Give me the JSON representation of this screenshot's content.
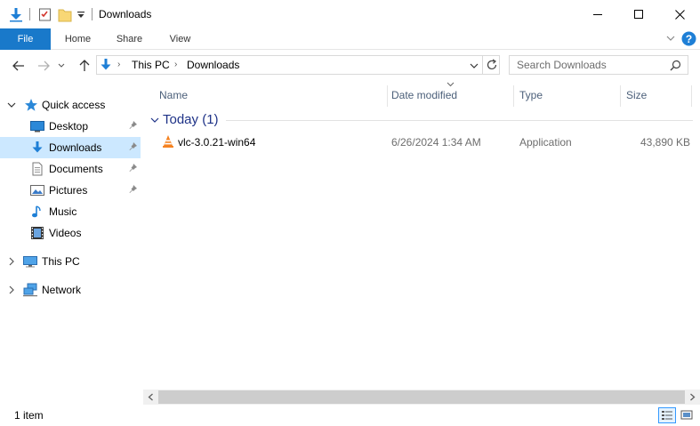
{
  "window": {
    "title": "Downloads",
    "controls": [
      "minimize-icon",
      "maximize-icon",
      "close-icon"
    ]
  },
  "ribbon": {
    "tabs": [
      {
        "label": "File",
        "active": true
      },
      {
        "label": "Home"
      },
      {
        "label": "Share"
      },
      {
        "label": "View"
      }
    ]
  },
  "address": {
    "crumbs": [
      "This PC",
      "Downloads"
    ]
  },
  "search": {
    "placeholder": "Search Downloads"
  },
  "nav": {
    "quick_access": "Quick access",
    "items": [
      {
        "label": "Desktop",
        "icon": "desktop-icon",
        "pinned": true
      },
      {
        "label": "Downloads",
        "icon": "downloads-icon",
        "pinned": true,
        "selected": true
      },
      {
        "label": "Documents",
        "icon": "documents-icon",
        "pinned": true
      },
      {
        "label": "Pictures",
        "icon": "pictures-icon",
        "pinned": true
      },
      {
        "label": "Music",
        "icon": "music-icon"
      },
      {
        "label": "Videos",
        "icon": "videos-icon"
      }
    ],
    "this_pc": "This PC",
    "network": "Network"
  },
  "columns": {
    "name": "Name",
    "date": "Date modified",
    "type": "Type",
    "size": "Size"
  },
  "group": {
    "label": "Today (1)"
  },
  "files": [
    {
      "name": "vlc-3.0.21-win64",
      "date": "6/26/2024 1:34 AM",
      "type": "Application",
      "size": "43,890 KB",
      "icon": "vlc-cone-icon"
    }
  ],
  "status": {
    "item_count": "1 item"
  },
  "colors": {
    "accent": "#1979ca",
    "selected": "#cce8ff",
    "group_label": "#1e3287",
    "column_header": "#4c607a"
  }
}
